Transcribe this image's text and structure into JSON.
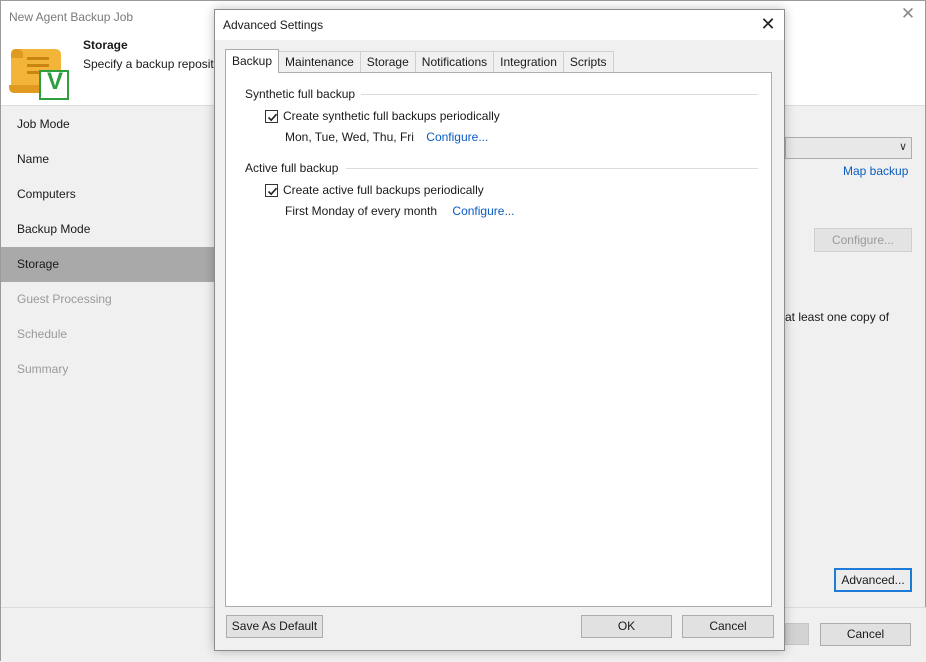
{
  "wizard": {
    "title": "New Agent Backup Job",
    "header_title": "Storage",
    "header_subtitle": "Specify a backup reposito",
    "steps": [
      {
        "label": "Job Mode"
      },
      {
        "label": "Name"
      },
      {
        "label": "Computers"
      },
      {
        "label": "Backup Mode"
      },
      {
        "label": "Storage"
      },
      {
        "label": "Guest Processing"
      },
      {
        "label": "Schedule"
      },
      {
        "label": "Summary"
      }
    ],
    "map_backup_label": "Map backup",
    "configure_label": "Configure...",
    "copy_text": "at least one copy of",
    "advanced_label": "Advanced...",
    "cancel_label": "Cancel",
    "logo_letter": "V"
  },
  "dialog": {
    "title": "Advanced Settings",
    "tabs": [
      {
        "label": "Backup"
      },
      {
        "label": "Maintenance"
      },
      {
        "label": "Storage"
      },
      {
        "label": "Notifications"
      },
      {
        "label": "Integration"
      },
      {
        "label": "Scripts"
      }
    ],
    "synthetic": {
      "header": "Synthetic full backup",
      "checkbox_label": "Create synthetic full backups periodically",
      "checked": true,
      "schedule": "Mon, Tue, Wed, Thu, Fri",
      "configure_label": "Configure..."
    },
    "active": {
      "header": "Active full backup",
      "checkbox_label": "Create active full backups periodically",
      "checked": true,
      "schedule": "First Monday of every month",
      "configure_label": "Configure..."
    },
    "save_default_label": "Save As Default",
    "ok_label": "OK",
    "cancel_label": "Cancel"
  },
  "colors": {
    "link": "#0a5bbf",
    "active_step": "#a9a9a9",
    "focus_border": "#1e7bd6",
    "logo_scroll": "#f2b53a",
    "logo_badge": "#2e9e3e"
  },
  "icons": [
    "close-icon",
    "chevron-down-icon",
    "checkmark-icon",
    "veeam-scroll-logo-icon"
  ]
}
